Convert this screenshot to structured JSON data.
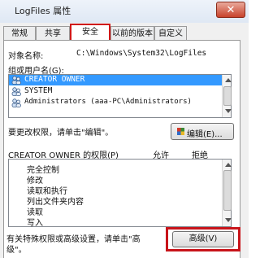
{
  "window": {
    "title": "LogFiles 属性",
    "close_label": "✕"
  },
  "tabs": [
    {
      "label": "常规"
    },
    {
      "label": "共享"
    },
    {
      "label": "安全"
    },
    {
      "label": "以前的版本"
    },
    {
      "label": "自定义"
    }
  ],
  "security": {
    "object_name_label": "对象名称:",
    "object_name_value": "C:\\Windows\\System32\\LogFiles",
    "groups_label": "组或用户名(G):",
    "users": [
      {
        "name": "CREATOR OWNER",
        "selected": true
      },
      {
        "name": "SYSTEM",
        "selected": false
      },
      {
        "name": "Administrators (aaa-PC\\Administrators)",
        "selected": false
      }
    ],
    "change_permissions_text": "要更改权限，请单击\"编辑\"。",
    "edit_button_label": "编辑(E)...",
    "permissions_for_label": "CREATOR OWNER 的权限(P)",
    "allow_header": "允许",
    "deny_header": "拒绝",
    "permissions": [
      {
        "name": "完全控制"
      },
      {
        "name": "修改"
      },
      {
        "name": "读取和执行"
      },
      {
        "name": "列出文件夹内容"
      },
      {
        "name": "读取"
      },
      {
        "name": "写入"
      }
    ],
    "special_permissions_text_line1": "有关特殊权限或高级设置，请单击\"高",
    "special_permissions_text_line2": "级\"。",
    "advanced_button_label": "高级(V)"
  },
  "colors": {
    "annotation": "#c8141a",
    "selection": "#3399ff"
  }
}
